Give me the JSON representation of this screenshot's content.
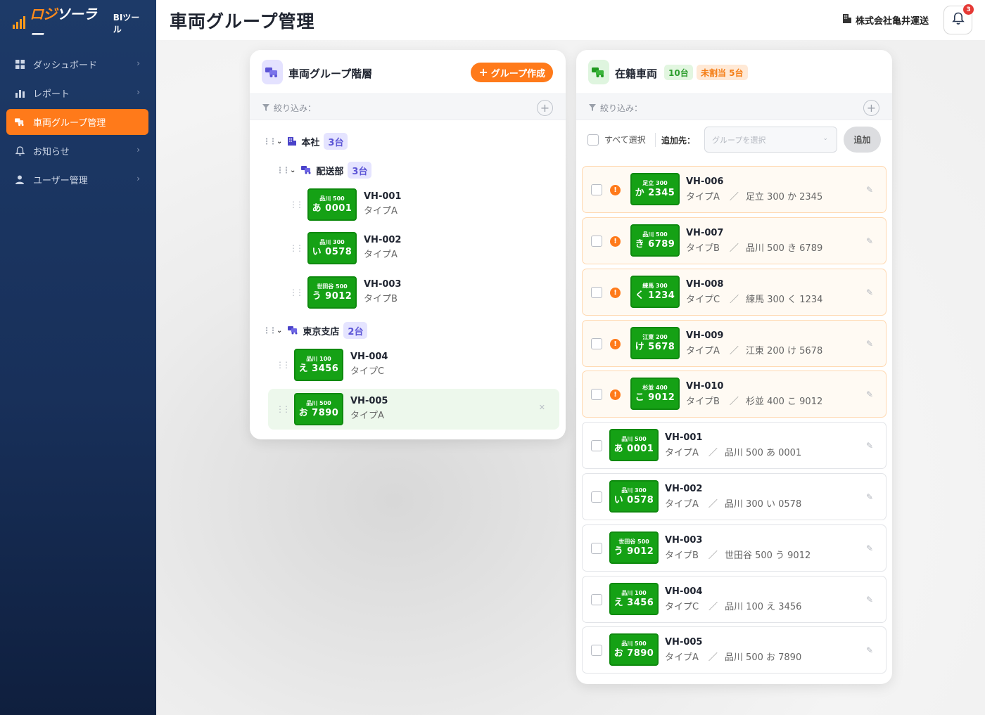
{
  "app": {
    "logo_text_a": "ロジ",
    "logo_text_b": "ソーラー",
    "logo_sub": "BIツール",
    "page_title": "車両グループ管理",
    "company": "株式会社亀井運送",
    "notification_count": "3"
  },
  "sidebar": {
    "items": [
      {
        "label": "ダッシュボード",
        "icon": "grid-icon"
      },
      {
        "label": "レポート",
        "icon": "bar-chart-icon"
      },
      {
        "label": "車両グループ管理",
        "icon": "trucks-icon"
      },
      {
        "label": "お知らせ",
        "icon": "bell-icon"
      },
      {
        "label": "ユーザー管理",
        "icon": "user-icon"
      }
    ]
  },
  "left_panel": {
    "title": "車両グループ階層",
    "create_button": "グループ作成",
    "filter_label": "絞り込み：",
    "groups": [
      {
        "name": "本社",
        "count": "3台"
      },
      {
        "name": "配送部",
        "count": "3台"
      },
      {
        "name": "東京支店",
        "count": "2台"
      }
    ],
    "vehicles": [
      {
        "plate_top": "品川 500",
        "plate_main": "あ 0001",
        "id": "VH-001",
        "type": "タイプA"
      },
      {
        "plate_top": "品川 300",
        "plate_main": "い 0578",
        "id": "VH-002",
        "type": "タイプA"
      },
      {
        "plate_top": "世田谷 500",
        "plate_main": "う 9012",
        "id": "VH-003",
        "type": "タイプB"
      },
      {
        "plate_top": "品川 100",
        "plate_main": "え 3456",
        "id": "VH-004",
        "type": "タイプC"
      },
      {
        "plate_top": "品川 500",
        "plate_main": "お 7890",
        "id": "VH-005",
        "type": "タイプA"
      }
    ]
  },
  "right_panel": {
    "title": "在籍車両",
    "total_chip": "10台",
    "unassigned_chip": "未割当 5台",
    "filter_label": "絞り込み：",
    "select_all": "すべて選択",
    "add_to_label": "追加先：",
    "group_select_placeholder": "グループを選択",
    "add_button": "追加",
    "vehicles": [
      {
        "plate_top": "足立 300",
        "plate_main": "か 2345",
        "id": "VH-006",
        "type": "タイプA",
        "plate_full": "足立 300 か 2345"
      },
      {
        "plate_top": "品川 500",
        "plate_main": "き 6789",
        "id": "VH-007",
        "type": "タイプB",
        "plate_full": "品川 500 き 6789"
      },
      {
        "plate_top": "練馬 300",
        "plate_main": "く 1234",
        "id": "VH-008",
        "type": "タイプC",
        "plate_full": "練馬 300 く 1234"
      },
      {
        "plate_top": "江東 200",
        "plate_main": "け 5678",
        "id": "VH-009",
        "type": "タイプA",
        "plate_full": "江東 200 け 5678"
      },
      {
        "plate_top": "杉並 400",
        "plate_main": "こ 9012",
        "id": "VH-010",
        "type": "タイプB",
        "plate_full": "杉並 400 こ 9012"
      },
      {
        "plate_top": "品川 500",
        "plate_main": "あ 0001",
        "id": "VH-001",
        "type": "タイプA",
        "plate_full": "品川 500 あ 0001"
      },
      {
        "plate_top": "品川 300",
        "plate_main": "い 0578",
        "id": "VH-002",
        "type": "タイプA",
        "plate_full": "品川 300 い 0578"
      },
      {
        "plate_top": "世田谷 500",
        "plate_main": "う 9012",
        "id": "VH-003",
        "type": "タイプB",
        "plate_full": "世田谷 500 う 9012"
      },
      {
        "plate_top": "品川 100",
        "plate_main": "え 3456",
        "id": "VH-004",
        "type": "タイプC",
        "plate_full": "品川 100 え 3456"
      },
      {
        "plate_top": "品川 500",
        "plate_main": "お 7890",
        "id": "VH-005",
        "type": "タイプA",
        "plate_full": "品川 500 お 7890"
      }
    ]
  },
  "colors": {
    "accent": "#ff7a1a",
    "plate_green": "#15a115",
    "sidebar_bg": "#1d3a68",
    "count_purple": "#5c55d6"
  }
}
